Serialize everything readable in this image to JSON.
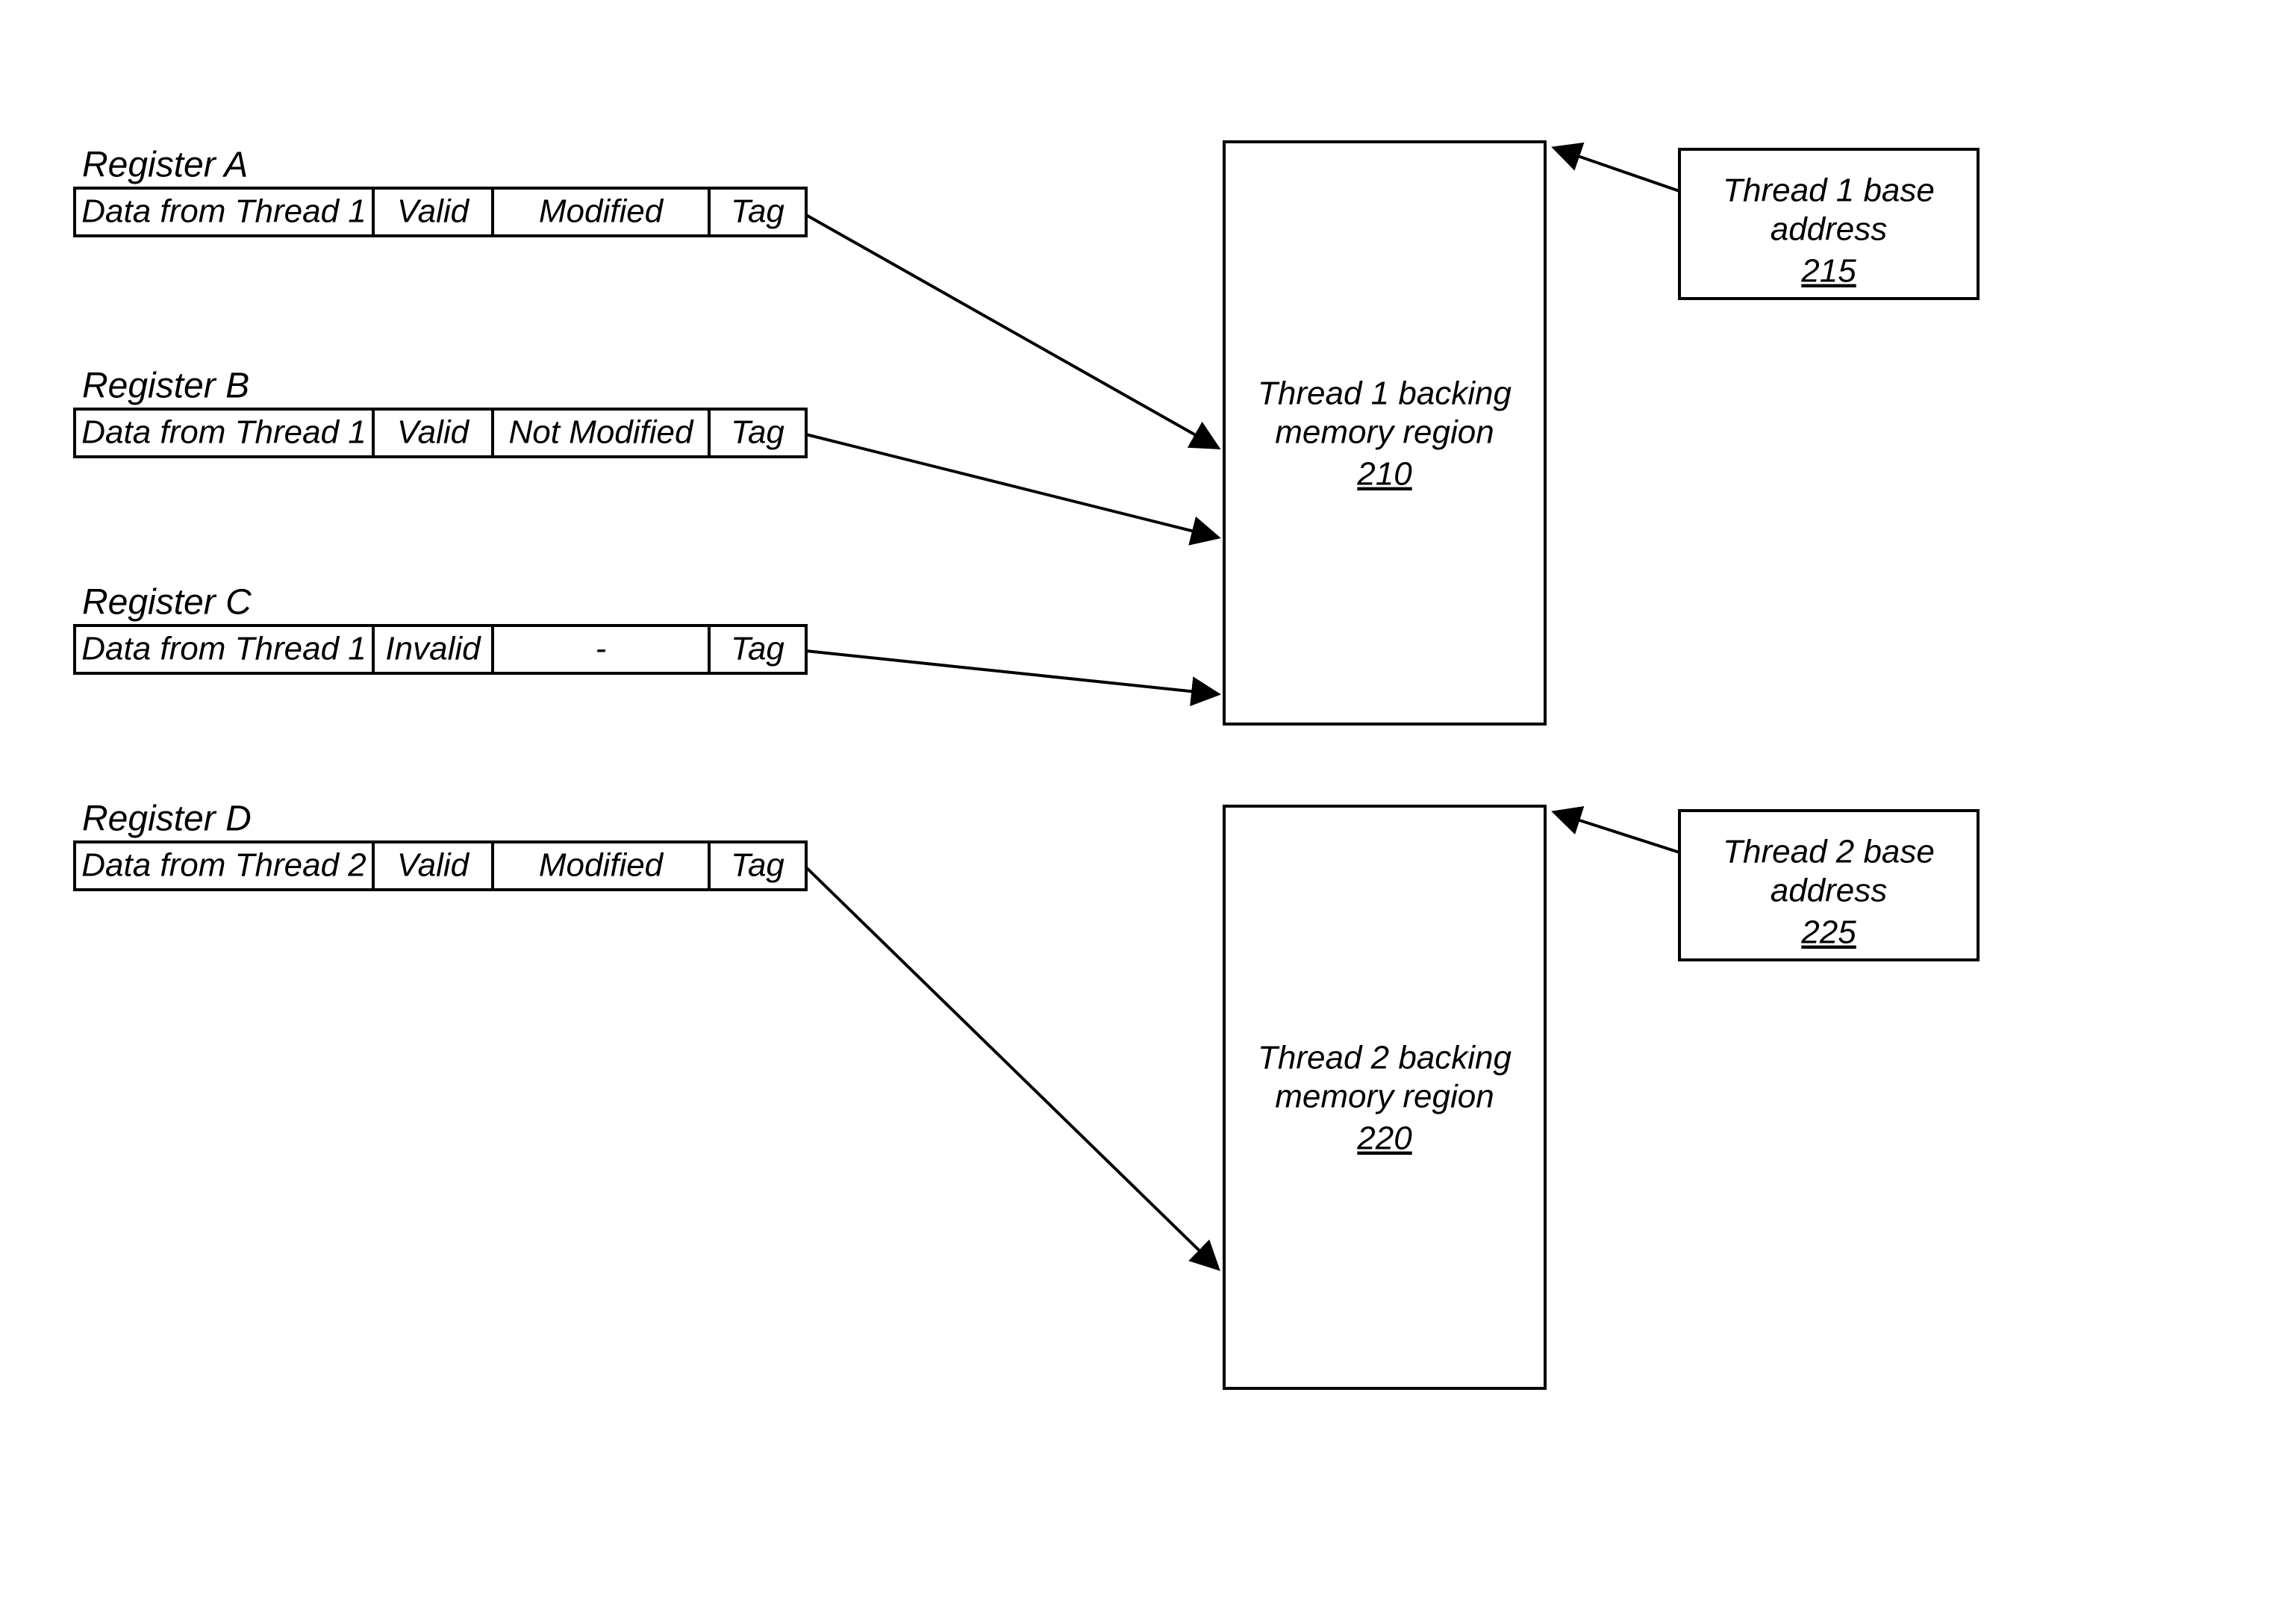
{
  "registers": {
    "A": {
      "title": "Register A",
      "data": "Data from Thread 1",
      "valid": "Valid",
      "modified": "Modified",
      "tag": "Tag"
    },
    "B": {
      "title": "Register B",
      "data": "Data from Thread 1",
      "valid": "Valid",
      "modified": "Not Modified",
      "tag": "Tag"
    },
    "C": {
      "title": "Register C",
      "data": "Data from Thread 1",
      "valid": "Invalid",
      "modified": "-",
      "tag": "Tag"
    },
    "D": {
      "title": "Register D",
      "data": "Data from Thread 2",
      "valid": "Valid",
      "modified": "Modified",
      "tag": "Tag"
    }
  },
  "regions": {
    "t1": {
      "line1": "Thread 1 backing",
      "line2": "memory region",
      "ref": "210"
    },
    "t2": {
      "line1": "Thread 2 backing",
      "line2": "memory region",
      "ref": "220"
    }
  },
  "addresses": {
    "t1": {
      "line1": "Thread 1 base",
      "line2": "address",
      "ref": "215"
    },
    "t2": {
      "line1": "Thread 2 base",
      "line2": "address",
      "ref": "225"
    }
  }
}
